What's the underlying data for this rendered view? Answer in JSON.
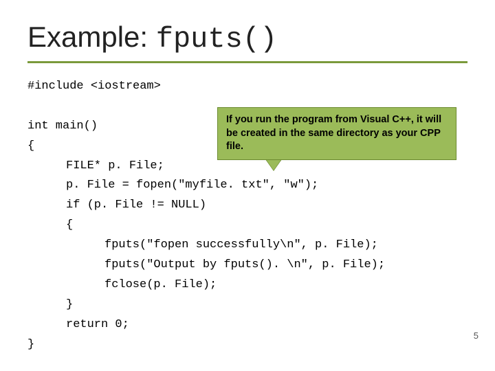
{
  "title_prefix": "Example: ",
  "title_mono": "fputs()",
  "code": {
    "l1": "#include <iostream>",
    "l2": "",
    "l3": "int main()",
    "l4": "{",
    "l5": "FILE* p. File;",
    "l6": "p. File = fopen(\"myfile. txt\", \"w\");",
    "l7": "if (p. File != NULL)",
    "l8": "{",
    "l9": "fputs(\"fopen successfully\\n\", p. File);",
    "l10": "fputs(\"Output by fputs(). \\n\", p. File);",
    "l11": "fclose(p. File);",
    "l12": "}",
    "l13": "return 0;",
    "l14": "}"
  },
  "callout_text": "If you run the program from Visual C++, it will be created in the same directory as your CPP file.",
  "page_number": "5"
}
